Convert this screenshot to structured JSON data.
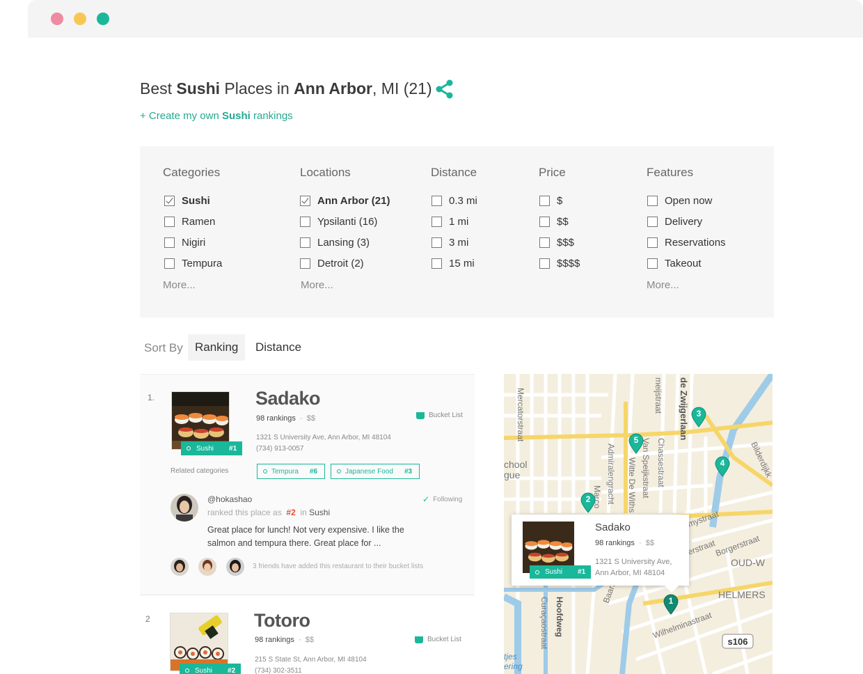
{
  "window": {
    "buttons": [
      "close",
      "minimize",
      "zoom"
    ]
  },
  "header": {
    "title_prefix": "Best ",
    "title_category": "Sushi",
    "title_mid": " Places in ",
    "title_city": "Ann Arbor",
    "title_suffix": ", MI (21)",
    "create_prefix": "+ Create my own ",
    "create_category": "Sushi",
    "create_suffix": " rankings"
  },
  "filters": {
    "categories": {
      "heading": "Categories",
      "items": [
        {
          "label": "Sushi",
          "checked": true
        },
        {
          "label": "Ramen",
          "checked": false
        },
        {
          "label": "Nigiri",
          "checked": false
        },
        {
          "label": "Tempura",
          "checked": false
        }
      ],
      "more": "More..."
    },
    "locations": {
      "heading": "Locations",
      "items": [
        {
          "label": "Ann Arbor (21)",
          "checked": true
        },
        {
          "label": "Ypsilanti (16)",
          "checked": false
        },
        {
          "label": "Lansing (3)",
          "checked": false
        },
        {
          "label": "Detroit (2)",
          "checked": false
        }
      ],
      "more": "More..."
    },
    "distance": {
      "heading": "Distance",
      "items": [
        {
          "label": "0.3 mi",
          "checked": false
        },
        {
          "label": "1 mi",
          "checked": false
        },
        {
          "label": "3 mi",
          "checked": false
        },
        {
          "label": "15 mi",
          "checked": false
        }
      ]
    },
    "price": {
      "heading": "Price",
      "items": [
        {
          "label": "$",
          "checked": false
        },
        {
          "label": "$$",
          "checked": false
        },
        {
          "label": "$$$",
          "checked": false
        },
        {
          "label": "$$$$",
          "checked": false
        }
      ]
    },
    "features": {
      "heading": "Features",
      "items": [
        {
          "label": "Open now",
          "checked": false
        },
        {
          "label": "Delivery",
          "checked": false
        },
        {
          "label": "Reservations",
          "checked": false
        },
        {
          "label": "Takeout",
          "checked": false
        }
      ],
      "more": "More..."
    }
  },
  "sort": {
    "label": "Sort By",
    "tabs": [
      "Ranking",
      "Distance"
    ],
    "active": "Ranking"
  },
  "listings": [
    {
      "rank": "1.",
      "name": "Sadako",
      "rankings": "98 rankings",
      "price": "$$",
      "address": "1321 S University Ave, Ann Arbor, MI 48104",
      "phone": "(734) 913-0057",
      "bucket_label": "Bucket List",
      "tag_category": "Sushi",
      "tag_rank": "#1",
      "related_label": "Related categories",
      "related": [
        {
          "label": "Tempura",
          "rank": "#6"
        },
        {
          "label": "Japanese Food",
          "rank": "#3"
        }
      ],
      "review": {
        "user": "@hokashao",
        "following": "Following",
        "ranked_prefix": "ranked this place as",
        "ranked_rank": "#2",
        "ranked_in": "in",
        "ranked_category": "Sushi",
        "text": "Great place for lunch! Not very expensive. I like the salmon and tempura there. Great place for ..."
      },
      "friends_text": "3 friends have added this restaurant to their bucket lists"
    },
    {
      "rank": "2",
      "name": "Totoro",
      "rankings": "98 rankings",
      "price": "$$",
      "address": "215 S State St, Ann Arbor, MI 48104",
      "phone": "(734) 302-3511",
      "bucket_label": "Bucket List",
      "tag_category": "Sushi",
      "tag_rank": "#2"
    }
  ],
  "map": {
    "popup": {
      "name": "Sadako",
      "rankings": "98 rankings",
      "price": "$$",
      "address_line1": "1321 S University Ave,",
      "address_line2": "Ann Arbor, MI 48104",
      "tag_category": "Sushi",
      "tag_rank": "#1"
    },
    "markers": [
      "1",
      "2",
      "3",
      "4",
      "5"
    ],
    "street_labels": [
      "Mercatorstraat",
      "meijstraat",
      "de Zwijgerlaan",
      "Admiralengracht",
      "Van Speijkstraat",
      "Chassestraat",
      "Witte De Withs",
      "Marco",
      "Bilderdijkk",
      "mystraat",
      "erstraat",
      "Borgerstraat",
      "OUD-W",
      "HELMERS",
      "Wilhelminastraat",
      "Baarsjesweg",
      "Curaçaostraat",
      "Hoofdweg",
      "chool",
      "gue",
      "tjes",
      "ering",
      "s106"
    ],
    "colors": {
      "water": "#9ecbe8",
      "road_major": "#f6d66a",
      "road_minor": "#ffffff",
      "land": "#f4eedf",
      "marker": "#1ab79a"
    }
  },
  "colors": {
    "accent": "#1ab79a",
    "rank_highlight": "#e94e30"
  }
}
